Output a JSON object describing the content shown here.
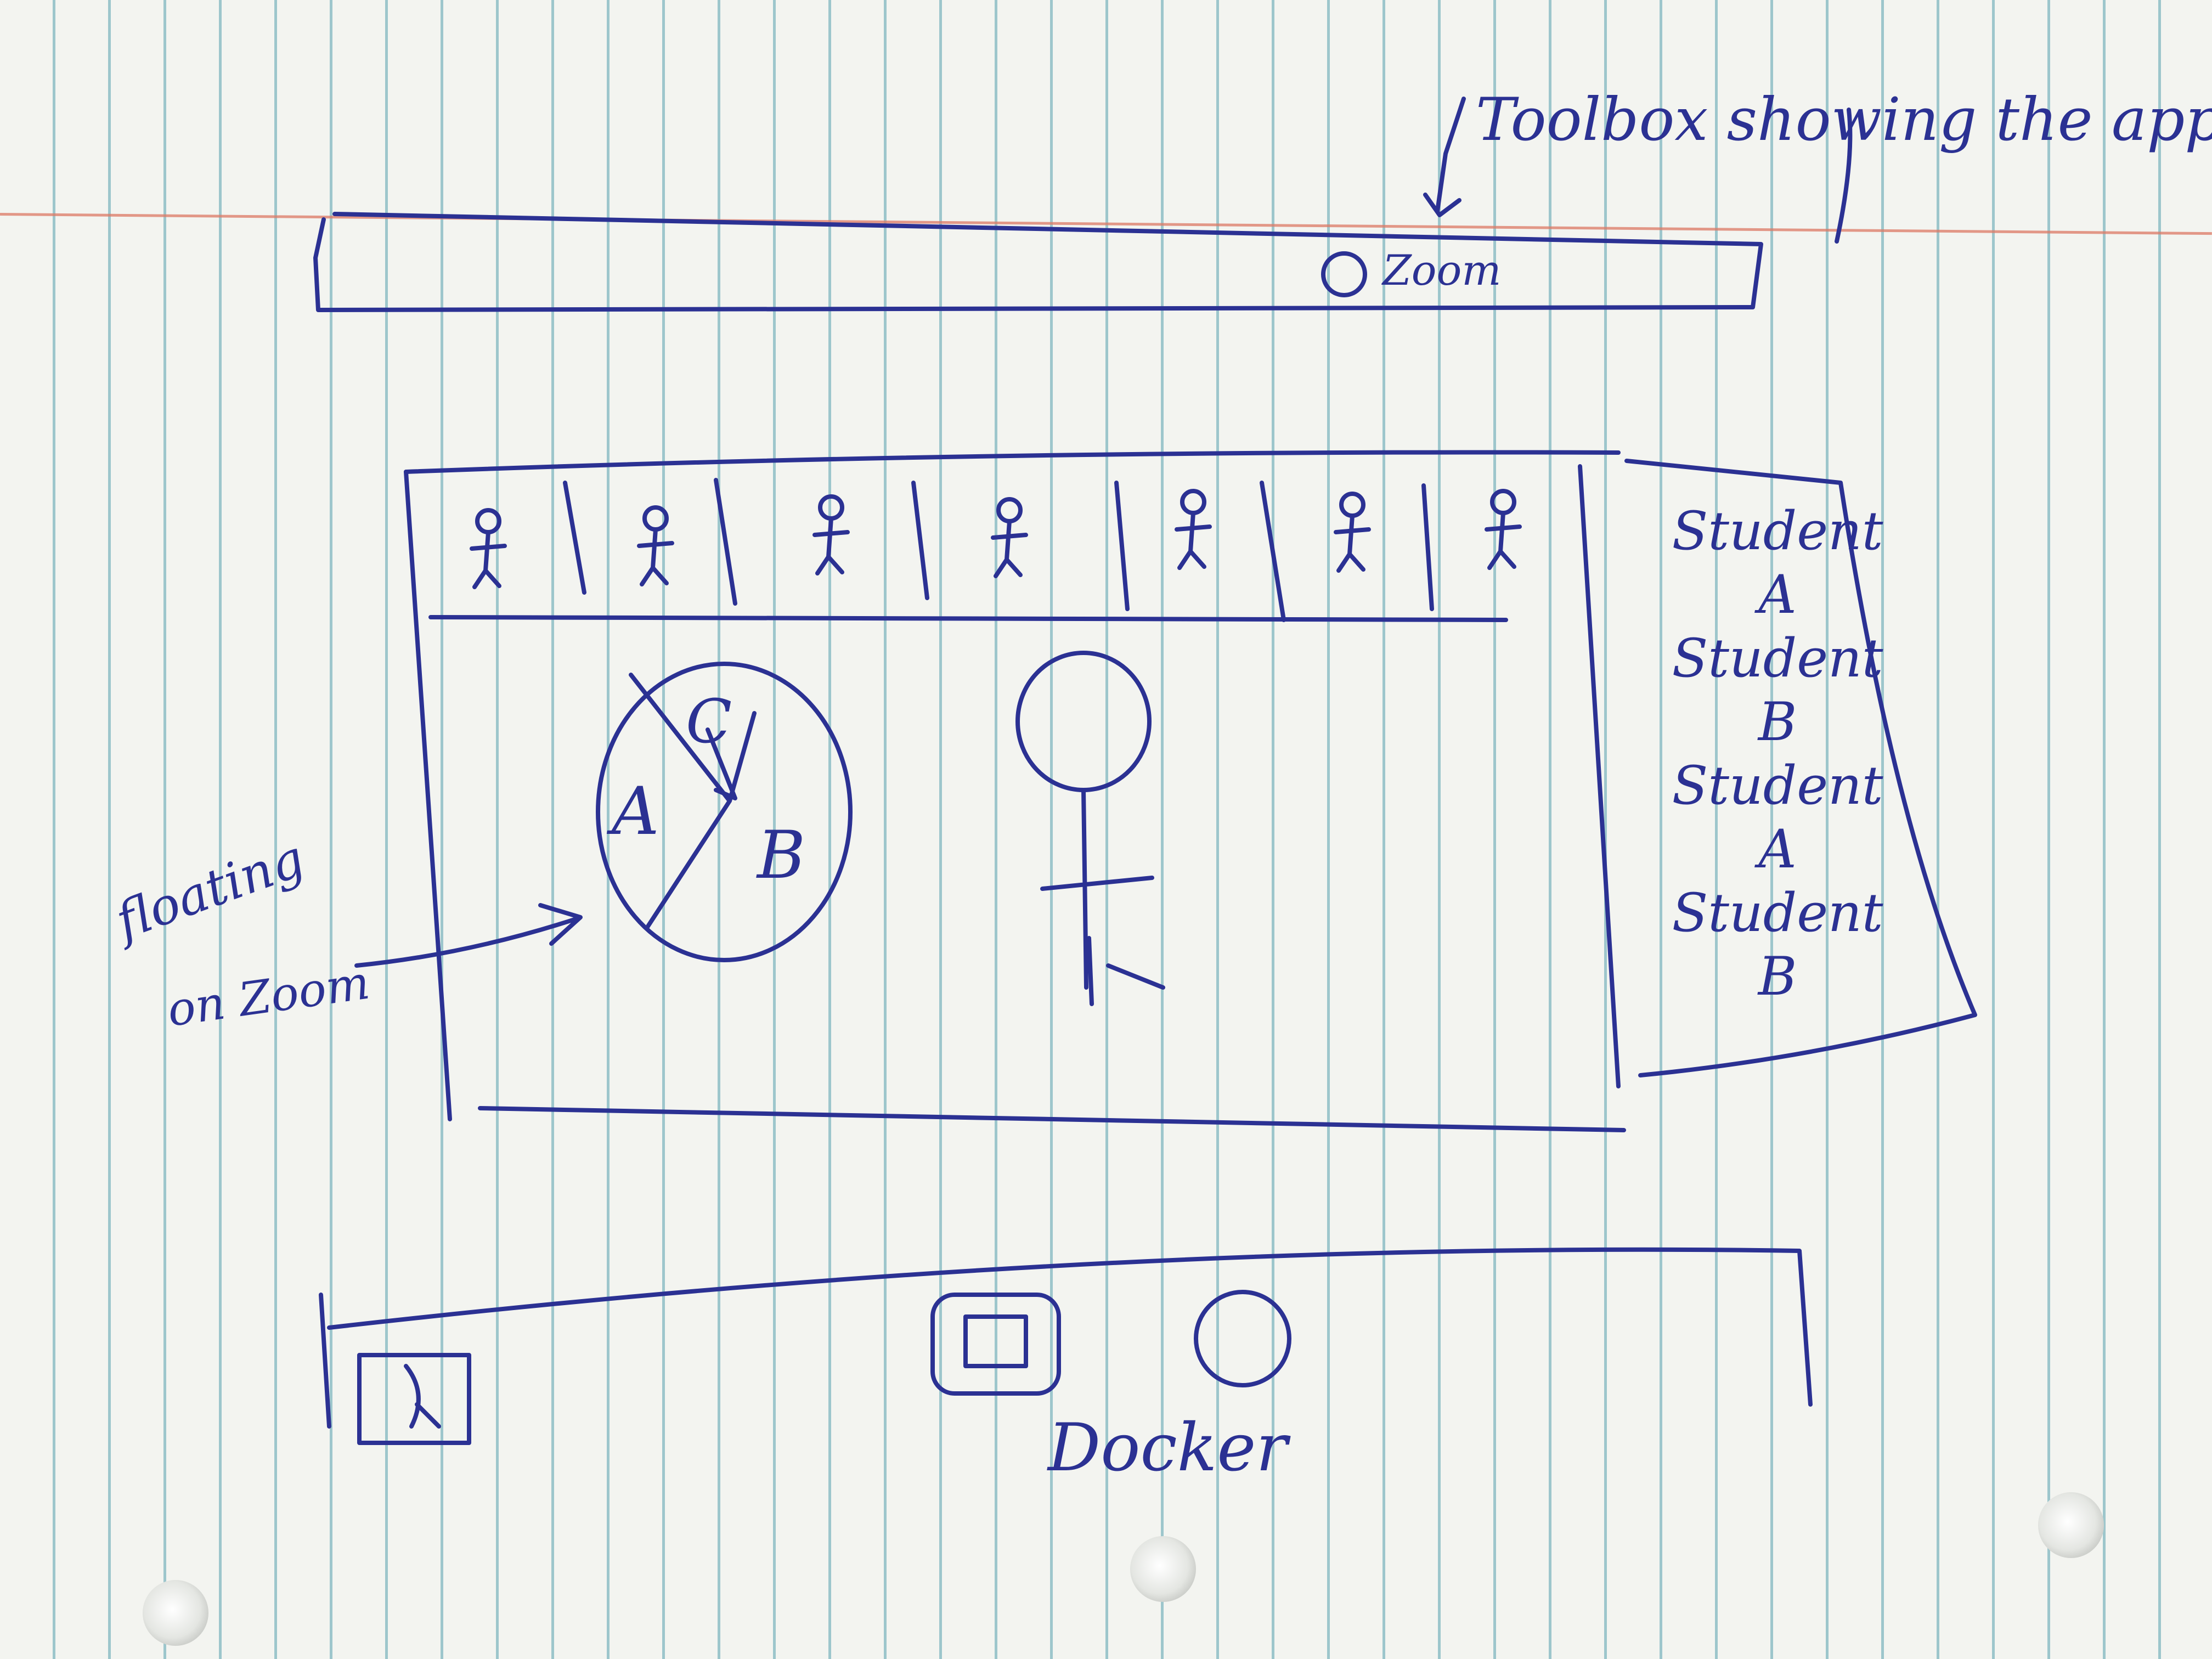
{
  "top_toolbar": {
    "annotation": "Toolbox showing the app is on.",
    "zoom_label": "Zoom"
  },
  "participants_strip": {
    "count": 7
  },
  "pie_chart": {
    "slices": [
      "A",
      "B",
      "C"
    ]
  },
  "floating_note": {
    "line1": "floating",
    "line2": "on Zoom"
  },
  "chat_panel": {
    "lines": [
      "Student",
      "A",
      "Student",
      "B",
      "Student",
      "A",
      "Student",
      "B"
    ]
  },
  "dock": {
    "label": "Docker"
  },
  "ink_color": "#2b3193"
}
